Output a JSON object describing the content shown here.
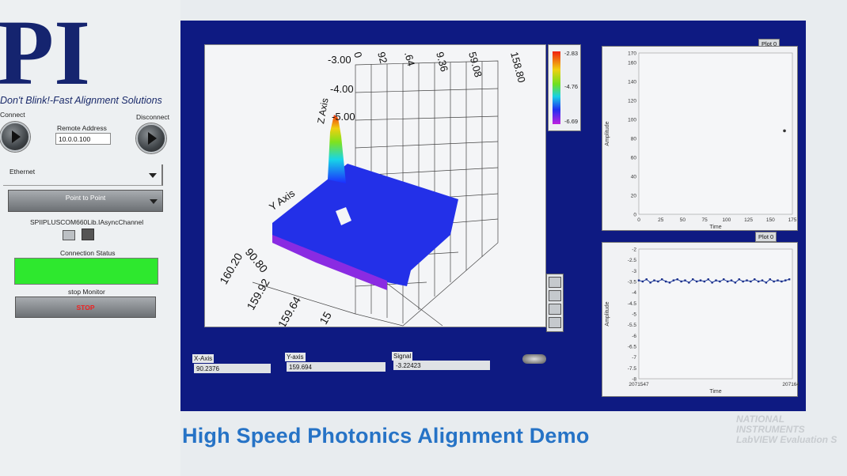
{
  "brand": {
    "logo_text": "PI",
    "tagline": "Don't Blink!-Fast Alignment Solutions"
  },
  "connection": {
    "connect_label": "Connect",
    "disconnect_label": "Disconnect",
    "remote_address_label": "Remote Address",
    "remote_address_value": "10.0.0.100",
    "interface_value": "Ethernet",
    "mode_value": "Point to Point",
    "channel_label": "SPIIPLUSCOM660Lib.IAsyncChannel",
    "status_label": "Connection Status",
    "status_color": "#2ee82e",
    "stop_monitor_label": "stop Monitor",
    "stop_button_label": "STOP"
  },
  "graph3d": {
    "z_axis_label": "Z Axis",
    "y_axis_label": "Y Axis",
    "z_ticks": [
      "-3.00",
      "-4.00",
      "-5.00"
    ],
    "top_ticks": [
      "0",
      "92",
      ".64",
      "9.36",
      "59.08",
      "158.80"
    ],
    "y_ticks": [
      "90.80",
      "160.20",
      "159.92",
      "159.64",
      "15"
    ],
    "colorscale_ticks": [
      "-2.83",
      "-4.76",
      "-6.69"
    ]
  },
  "outputs": {
    "x_label": "X-Axis",
    "x_value": "90.2376",
    "y_label": "Y-axis",
    "y_value": "159.694",
    "signal_label": "Signal",
    "signal_value": "-3.22423"
  },
  "plot_top": {
    "legend": "Plot 0",
    "xlabel": "Time",
    "ylabel": "Amplitude",
    "chart_data": {
      "type": "scatter",
      "x_ticks": [
        "0",
        "25",
        "50",
        "75",
        "100",
        "125",
        "150",
        "175"
      ],
      "y_ticks": [
        "170",
        "160",
        "140",
        "120",
        "100",
        "80",
        "60",
        "40",
        "20",
        "0"
      ],
      "xlim": [
        0,
        175
      ],
      "ylim": [
        0,
        170
      ],
      "series": [
        {
          "x": [
            166
          ],
          "y": [
            88
          ]
        }
      ]
    }
  },
  "plot_bottom": {
    "legend": "Plot 0",
    "xlabel": "Time",
    "ylabel": "Amplitude",
    "chart_data": {
      "type": "line",
      "x_ticks": [
        "2071547",
        "2071647"
      ],
      "y_ticks": [
        "-2",
        "-2.5",
        "-3",
        "-3.5",
        "-4",
        "-4.5",
        "-5",
        "-5.5",
        "-6",
        "-6.5",
        "-7",
        "-7.5",
        "-8"
      ],
      "xlim": [
        2071547,
        2071647
      ],
      "ylim": [
        -8,
        -2
      ],
      "series": [
        {
          "y": [
            -3.45,
            -3.5,
            -3.4,
            -3.55,
            -3.45,
            -3.5,
            -3.4,
            -3.5,
            -3.55,
            -3.45,
            -3.4,
            -3.5,
            -3.45,
            -3.55,
            -3.4,
            -3.5,
            -3.45,
            -3.5,
            -3.4,
            -3.55,
            -3.45,
            -3.5,
            -3.4,
            -3.5,
            -3.45,
            -3.55,
            -3.4,
            -3.5,
            -3.45,
            -3.5,
            -3.4,
            -3.5,
            -3.45,
            -3.55,
            -3.4,
            -3.5,
            -3.45,
            -3.5,
            -3.45,
            -3.4
          ]
        }
      ]
    }
  },
  "caption": "High Speed Photonics Alignment Demo",
  "watermark": {
    "line1": "NATIONAL",
    "line2": "INSTRUMENTS",
    "line3": "LabVIEW Evaluation S"
  }
}
